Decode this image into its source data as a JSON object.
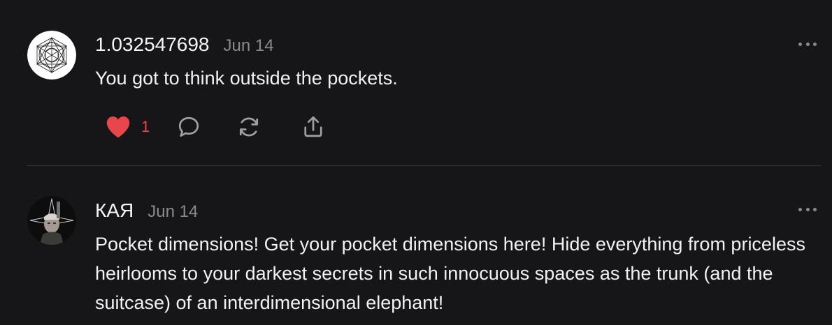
{
  "posts": [
    {
      "username": "1.032547698",
      "date": "Jun 14",
      "text": "You got to think outside the pockets.",
      "likes": "1",
      "liked": true
    },
    {
      "username": "КАЯ",
      "date": "Jun 14",
      "text": "Pocket dimensions! Get your pocket dimensions here! Hide everything from priceless heirlooms to your darkest secrets in such innocuous spaces as the trunk (and the suitcase) of an interdimensional elephant!"
    }
  ],
  "colors": {
    "background": "#161618",
    "text": "#f2f2f2",
    "muted": "#8a8a8e",
    "like": "#e8464a"
  },
  "icons": [
    "heart-icon",
    "comment-icon",
    "repost-icon",
    "share-icon",
    "more-options-icon"
  ]
}
